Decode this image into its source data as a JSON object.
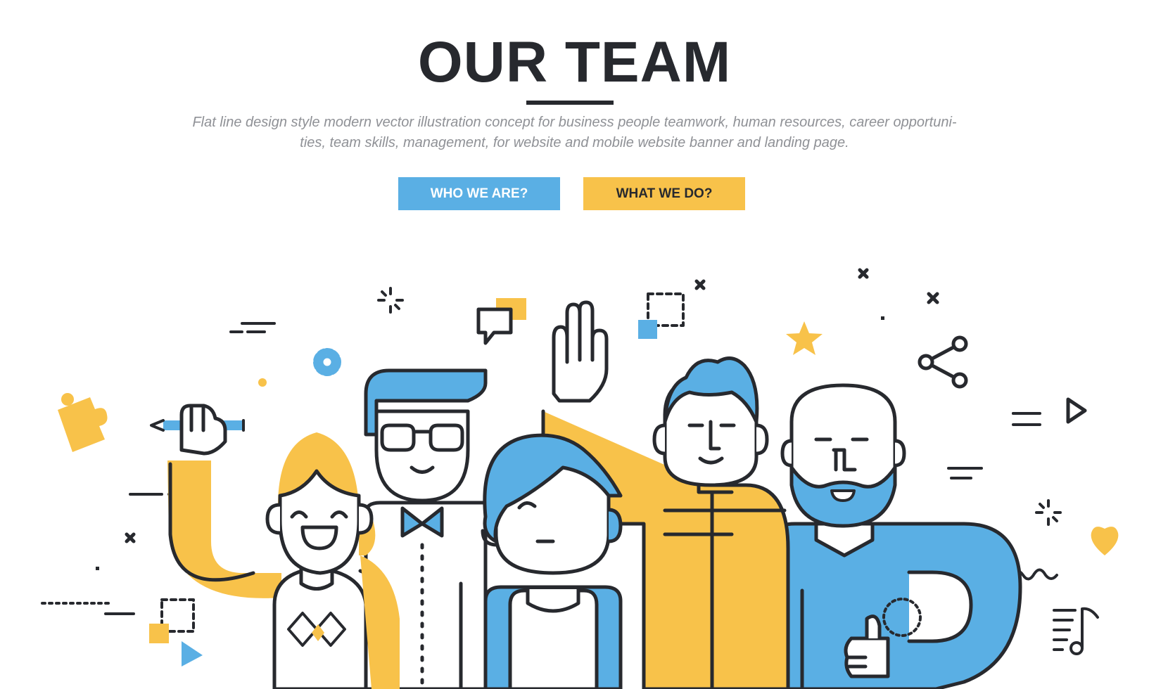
{
  "header": {
    "title": "OUR TEAM",
    "subtitle_line1": "Flat line design style modern vector illustration concept for business people teamwork, human resources, career opportuni-",
    "subtitle_line2": "ties, team skills, management, for website and mobile website banner and landing page."
  },
  "buttons": {
    "who_label": "WHO WE ARE?",
    "what_label": "WHAT WE DO?"
  },
  "colors": {
    "blue": "#5aafe4",
    "yellow": "#f8c24a",
    "ink": "#27292e",
    "text_gray": "#8f9196"
  },
  "illustration": {
    "people": [
      "woman-with-pencil",
      "man-with-glasses",
      "woman-blue-hair",
      "man-raising-hand",
      "bald-bearded-man"
    ],
    "icons": [
      "puzzle-icon",
      "gear-icon",
      "chat-bubble-icon",
      "raised-hand-icon",
      "star-icon",
      "share-icon",
      "play-icon",
      "heart-icon",
      "music-note-icon",
      "thumbs-up-icon"
    ]
  }
}
